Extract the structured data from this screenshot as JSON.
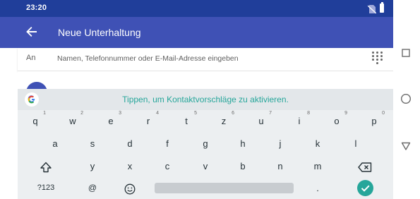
{
  "status_bar": {
    "time": "23:20"
  },
  "app_bar": {
    "title": "Neue Unterhaltung"
  },
  "to_field": {
    "label": "An",
    "placeholder": "Namen, Telefonnummer oder E-Mail-Adresse eingeben"
  },
  "keyboard": {
    "suggestion": "Tippen, um Kontaktvorschläge zu aktivieren.",
    "row1": [
      {
        "k": "q",
        "h": "1"
      },
      {
        "k": "w",
        "h": "2"
      },
      {
        "k": "e",
        "h": "3"
      },
      {
        "k": "r",
        "h": "4"
      },
      {
        "k": "t",
        "h": "5"
      },
      {
        "k": "z",
        "h": "6"
      },
      {
        "k": "u",
        "h": "7"
      },
      {
        "k": "i",
        "h": "8"
      },
      {
        "k": "o",
        "h": "9"
      },
      {
        "k": "p",
        "h": "0"
      }
    ],
    "row2": [
      "a",
      "s",
      "d",
      "f",
      "g",
      "h",
      "j",
      "k",
      "l"
    ],
    "row3": [
      "y",
      "x",
      "c",
      "v",
      "b",
      "n",
      "m"
    ],
    "symbols_label": "?123",
    "at_label": "@",
    "period_label": ".",
    "colors": {
      "accent": "#26a69a",
      "appbar": "#3f51b5",
      "statusbar": "#203e9a"
    }
  }
}
